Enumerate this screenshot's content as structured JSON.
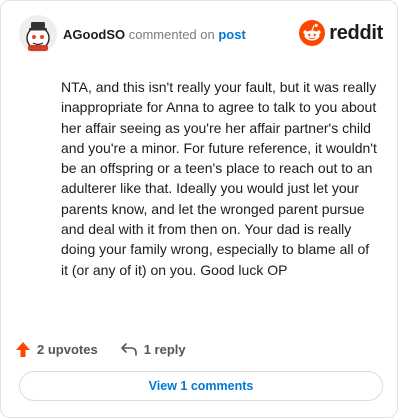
{
  "comment": {
    "author": "AGoodSO",
    "action_text": "commented on",
    "target_text": "post",
    "body": "NTA, and this isn't really your fault, but it was really inappropriate for Anna to agree to talk to you about her affair seeing as you're her affair partner's child and you're a minor. For future reference, it wouldn't be an offspring or a teen's place to reach out to an adulterer like that. Ideally you would just let your parents know, and let the wronged parent pursue and deal with it from then on. Your dad is really doing your family wrong, especially to blame all of it (or any of it) on you. Good luck OP",
    "upvotes_label": "2 upvotes",
    "reply_label": "1 reply",
    "view_comments_label": "View 1 comments"
  },
  "brand": {
    "name": "reddit",
    "color": "#ff4500"
  },
  "icons": {
    "avatar": "snoo-avatar-icon",
    "logo": "reddit-logo-icon",
    "upvote": "upvote-arrow-icon",
    "reply": "reply-arrow-icon"
  },
  "colors": {
    "upvote": "#ff4500",
    "link": "#0079d3",
    "muted": "#7c7c7c"
  }
}
